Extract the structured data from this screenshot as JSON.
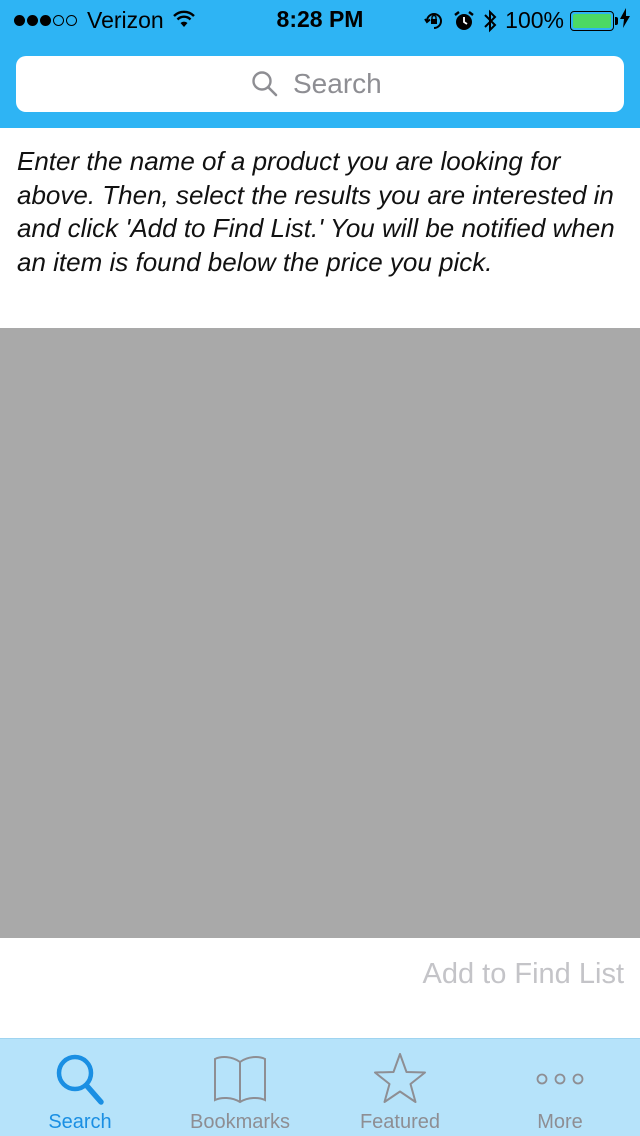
{
  "status_bar": {
    "carrier": "Verizon",
    "time": "8:28 PM",
    "battery_percent": "100%",
    "signal_bars_filled": 3,
    "signal_bars_total": 5,
    "battery_level": 1.0,
    "icons": [
      "wifi-icon",
      "orientation-lock-icon",
      "alarm-icon",
      "bluetooth-icon",
      "battery-icon",
      "charging-icon"
    ]
  },
  "search": {
    "placeholder": "Search",
    "value": "",
    "icon": "search-icon"
  },
  "instructions": "Enter the name of a product you are looking for above. Then, select the results you are interested in and click 'Add to Find List.' You will be notified when an item is found below the price you pick.",
  "actions": {
    "add_to_find_list": "Add to Find List"
  },
  "tabs": [
    {
      "label": "Search",
      "icon": "search-icon",
      "active": true
    },
    {
      "label": "Bookmarks",
      "icon": "book-icon",
      "active": false
    },
    {
      "label": "Featured",
      "icon": "star-icon",
      "active": false
    },
    {
      "label": "More",
      "icon": "more-icon",
      "active": false
    }
  ],
  "colors": {
    "header": "#2eb4f4",
    "tab_bar": "#b6e3fa",
    "active_tab": "#1a8fe3",
    "inactive_tab": "#8e8e93",
    "results_area": "#a9a9a9",
    "disabled_action": "#c4c4c8",
    "battery_fill": "#4cd964"
  }
}
